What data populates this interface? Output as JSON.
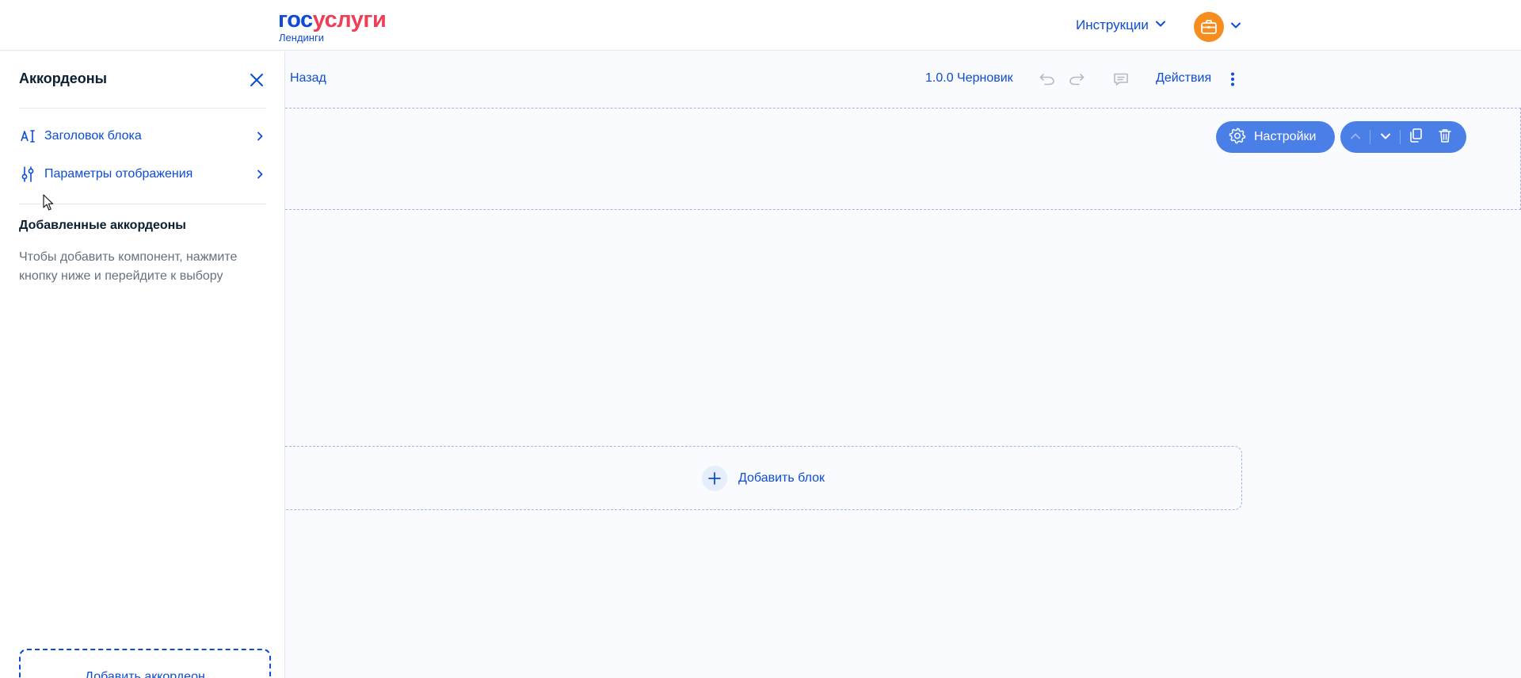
{
  "header": {
    "logo_part1": "гос",
    "logo_part2": "услуги",
    "logo_sub": "Лендинги",
    "instructions_label": "Инструкции",
    "avatar_icon": "briefcase-icon"
  },
  "sidebar": {
    "title": "Аккордеоны",
    "items": [
      {
        "label": "Заголовок блока",
        "icon": "text-cursor-icon"
      },
      {
        "label": "Параметры отображения",
        "icon": "sliders-icon"
      }
    ],
    "section_title": "Добавленные аккордеоны",
    "hint": "Чтобы добавить компонент, нажмите кнопку ниже и перейдите к выбору",
    "add_button": "Добавить аккордеон"
  },
  "toolbar": {
    "back_label": "Назад",
    "version_label": "1.0.0 Черновик",
    "actions_label": "Действия"
  },
  "block": {
    "settings_label": "Настройки"
  },
  "add_block": {
    "label": "Добавить блок"
  },
  "colors": {
    "primary": "#0d4cd3",
    "accent_red": "#ee3f58",
    "button_blue": "#4a7fe7",
    "avatar_orange": "#f68d1e",
    "background": "#f9fbfe"
  }
}
